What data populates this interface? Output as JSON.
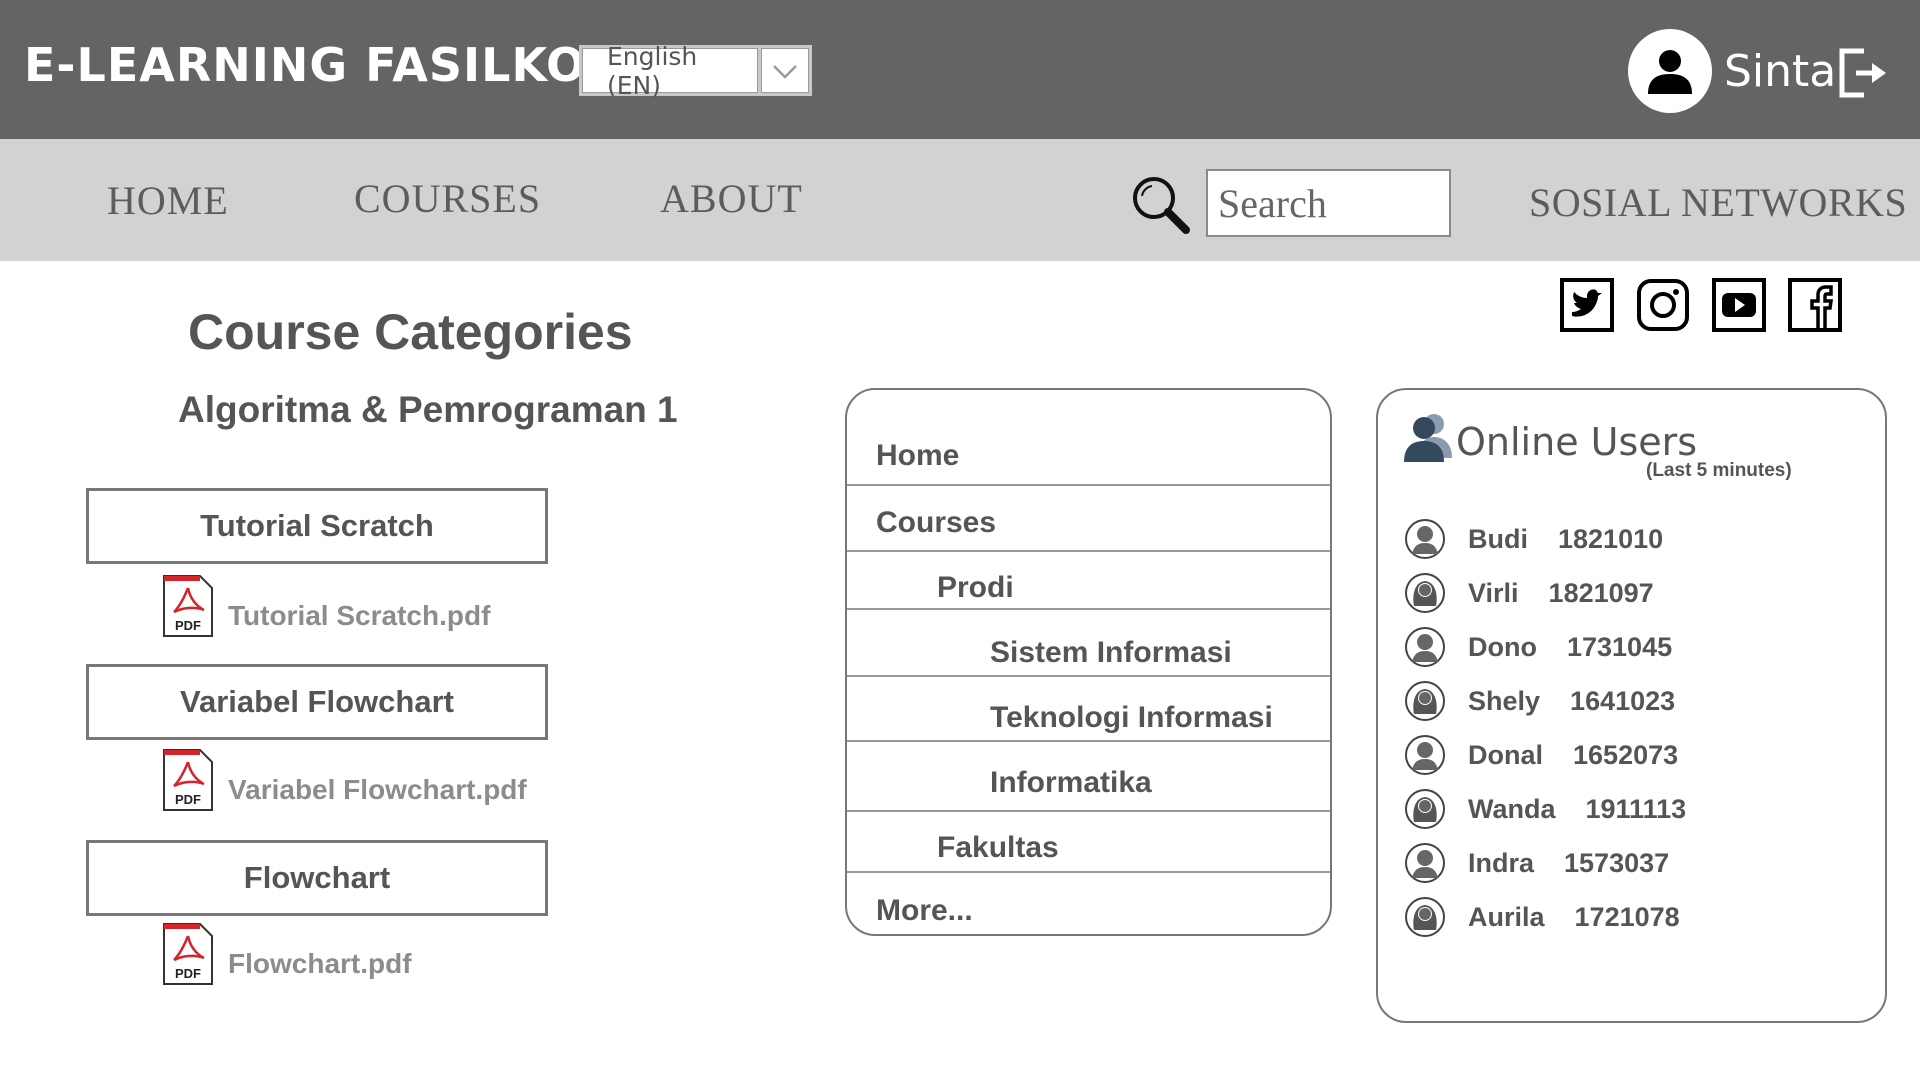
{
  "header": {
    "app_title": "E-LEARNING FASILKOM",
    "language": {
      "selected": "English (EN)"
    },
    "user": {
      "name": "Sinta"
    },
    "icons": {
      "avatar": "user-icon",
      "logout": "logout-icon"
    }
  },
  "nav": {
    "links": [
      "HOME",
      "COURSES",
      "ABOUT"
    ],
    "search": {
      "placeholder": "Search"
    },
    "social_label": "SOSIAL NETWORKS"
  },
  "social_icons": [
    "twitter-icon",
    "instagram-icon",
    "youtube-icon",
    "facebook-icon"
  ],
  "courses": {
    "title": "Course Categories",
    "subtitle": "Algoritma & Pemrograman 1",
    "items": [
      {
        "label": "Tutorial Scratch",
        "file": "Tutorial Scratch.pdf"
      },
      {
        "label": "Variabel Flowchart",
        "file": "Variabel Flowchart.pdf"
      },
      {
        "label": "Flowchart",
        "file": "Flowchart.pdf"
      }
    ]
  },
  "menu": {
    "items": [
      "Home",
      "Courses",
      "Prodi",
      "Sistem Informasi",
      "Teknologi Informasi",
      "Informatika",
      "Fakultas",
      "More..."
    ]
  },
  "online_users": {
    "title": "Online Users",
    "subtitle": "(Last 5 minutes)",
    "users": [
      {
        "name": "Budi",
        "id": "1821010"
      },
      {
        "name": "Virli",
        "id": "1821097"
      },
      {
        "name": "Dono",
        "id": "1731045"
      },
      {
        "name": "Shely",
        "id": "1641023"
      },
      {
        "name": "Donal",
        "id": "1652073"
      },
      {
        "name": "Wanda",
        "id": "1911113"
      },
      {
        "name": "Indra",
        "id": "1573037"
      },
      {
        "name": "Aurila",
        "id": "1721078"
      }
    ]
  },
  "colors": {
    "topbar": "#646365",
    "navbar": "#d3d2d3",
    "text": "#555555",
    "pdf_red": "#d6242a"
  }
}
